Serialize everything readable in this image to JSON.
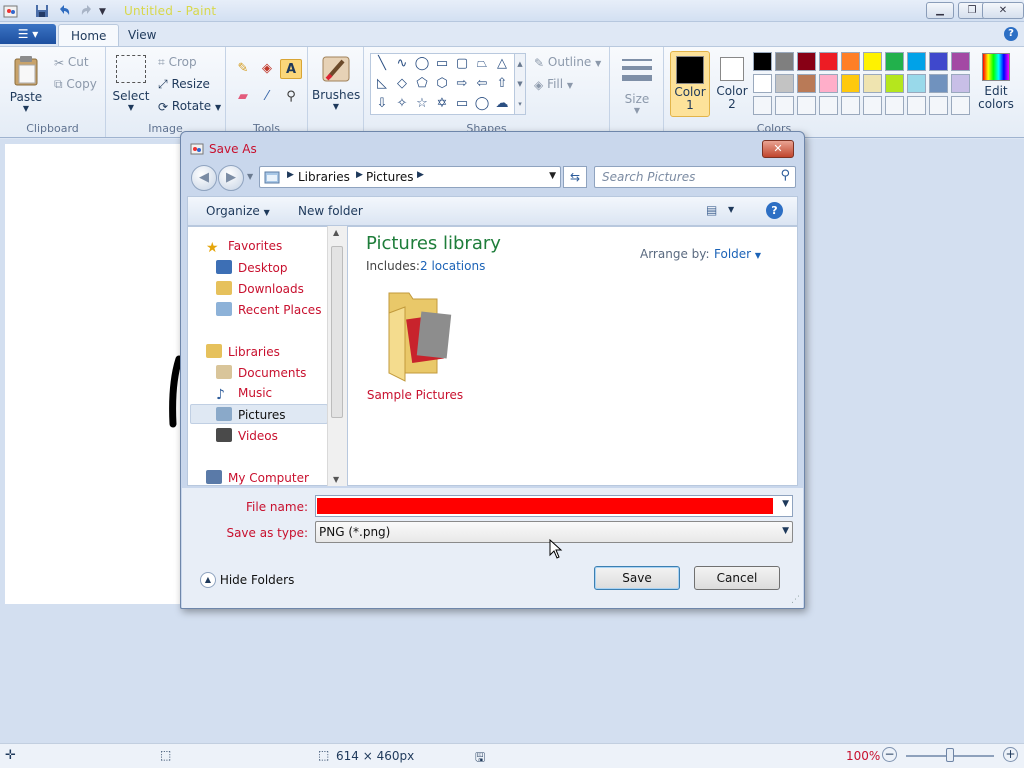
{
  "window": {
    "title": "Untitled - Paint"
  },
  "ribbon": {
    "tabs": [
      "Home",
      "View"
    ],
    "groups": {
      "clipboard": {
        "label": "Clipboard",
        "paste": "Paste",
        "cut": "Cut",
        "copy": "Copy"
      },
      "image": {
        "label": "Image",
        "select": "Select",
        "crop": "Crop",
        "resize": "Resize",
        "rotate": "Rotate"
      },
      "tools": {
        "label": "Tools"
      },
      "brushes": {
        "label": "Brushes"
      },
      "shapes": {
        "label": "Shapes",
        "outline": "Outline",
        "fill": "Fill"
      },
      "size": {
        "label": "Size"
      },
      "colors": {
        "label": "Colors",
        "color1": "Color 1",
        "color2": "Color 2",
        "edit": "Edit colors",
        "palette": [
          "#000000",
          "#7f7f7f",
          "#880015",
          "#ed1c24",
          "#ff7f27",
          "#fff200",
          "#22b14c",
          "#00a2e8",
          "#3f48cc",
          "#a349a4",
          "#ffffff",
          "#c3c3c3",
          "#b97a57",
          "#ffaec9",
          "#ffc90e",
          "#efe4b0",
          "#b5e61d",
          "#99d9ea",
          "#7092be",
          "#c8bfe7"
        ]
      }
    }
  },
  "dialog": {
    "title": "Save As",
    "address": {
      "segments": [
        "Libraries",
        "Pictures"
      ]
    },
    "search_placeholder": "Search Pictures",
    "toolbar": {
      "organize": "Organize",
      "new_folder": "New folder"
    },
    "nav": {
      "favorites": "Favorites",
      "desktop": "Desktop",
      "downloads": "Downloads",
      "recent": "Recent Places",
      "libraries": "Libraries",
      "documents": "Documents",
      "music": "Music",
      "pictures": "Pictures",
      "videos": "Videos",
      "computer": "My Computer"
    },
    "library": {
      "title": "Pictures library",
      "includes_label": "Includes:",
      "includes_link": "2 locations",
      "arrange_label": "Arrange by:",
      "arrange_value": "Folder"
    },
    "items": [
      {
        "name": "Sample Pictures"
      }
    ],
    "file_name_label": "File name:",
    "file_name_value": "",
    "save_type_label": "Save as type:",
    "save_type_value": "PNG (*.png)",
    "hide_folders": "Hide Folders",
    "save": "Save",
    "cancel": "Cancel"
  },
  "status": {
    "dimensions": "614 × 460px",
    "zoom": "100%"
  }
}
